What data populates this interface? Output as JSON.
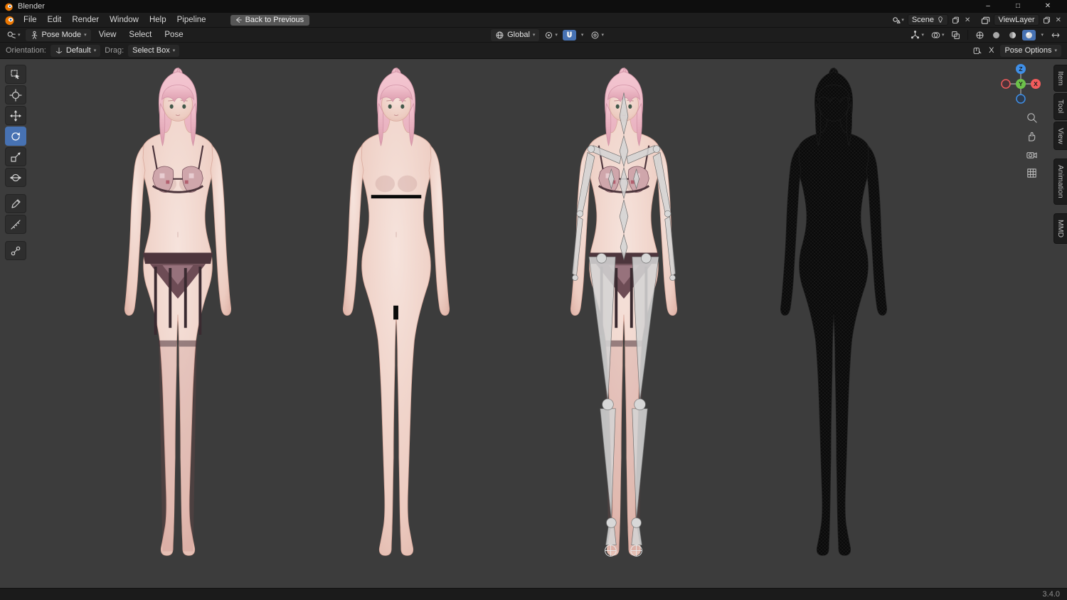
{
  "titlebar": {
    "title": "Blender",
    "minimize": "–",
    "maximize": "□",
    "close": "✕"
  },
  "menubar": {
    "menus": [
      "File",
      "Edit",
      "Render",
      "Window",
      "Help",
      "Pipeline"
    ],
    "back_button": "Back to Previous",
    "scene": {
      "label": "Scene"
    },
    "viewlayer": {
      "label": "ViewLayer"
    }
  },
  "header": {
    "mode": "Pose Mode",
    "menus": [
      "View",
      "Select",
      "Pose"
    ],
    "orientation": "Global"
  },
  "tool_settings": {
    "orientation_label": "Orientation:",
    "orientation_value": "Default",
    "drag_label": "Drag:",
    "drag_value": "Select Box",
    "close": "X",
    "pose_options": "Pose Options"
  },
  "toolbar": {
    "tools": [
      "tweak-select",
      "cursor-3d",
      "move",
      "rotate",
      "scale",
      "transform",
      "annotate",
      "measure",
      "pose-tool"
    ],
    "active_tool": "rotate"
  },
  "gizmo": {
    "x": "X",
    "y": "Y",
    "z": "Z"
  },
  "sidebar_tabs": [
    "Item",
    "Tool",
    "View",
    "Animation",
    "MMD"
  ],
  "viewport": {
    "models": [
      "textured lingerie model",
      "base body model",
      "armature pose model",
      "wireframe model"
    ]
  },
  "statusbar": {
    "version": "3.4.0"
  },
  "colors": {
    "accent": "#4772b3",
    "axis_x": "#f25c5c",
    "axis_y": "#6cc24a",
    "axis_z": "#3f8fe8",
    "viewport_bg": "#3c3c3c",
    "skin": "#edd0c8",
    "hair": "#eeb0bf"
  }
}
